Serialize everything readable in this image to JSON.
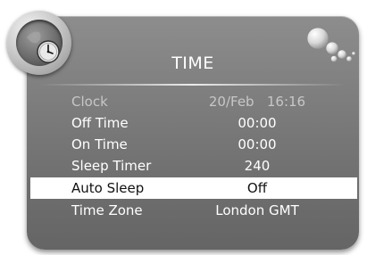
{
  "menu": {
    "title": "TIME",
    "items": [
      {
        "label": "Clock",
        "value": "20/Feb   16:16",
        "state": "disabled"
      },
      {
        "label": "Off Time",
        "value": "00:00",
        "state": "normal"
      },
      {
        "label": "On Time",
        "value": "00:00",
        "state": "normal"
      },
      {
        "label": "Sleep Timer",
        "value": "240",
        "state": "normal"
      },
      {
        "label": "Auto Sleep",
        "value": "Off",
        "state": "selected"
      },
      {
        "label": "Time Zone",
        "value": "London GMT",
        "state": "normal"
      }
    ]
  },
  "icons": {
    "badge": "clock-icon",
    "decoration": "bubbles-icon"
  },
  "colors": {
    "panel": "#7e7e7e",
    "selected_row": "#ffffff",
    "text": "#ffffff",
    "disabled_text": "#c7c7c7"
  }
}
